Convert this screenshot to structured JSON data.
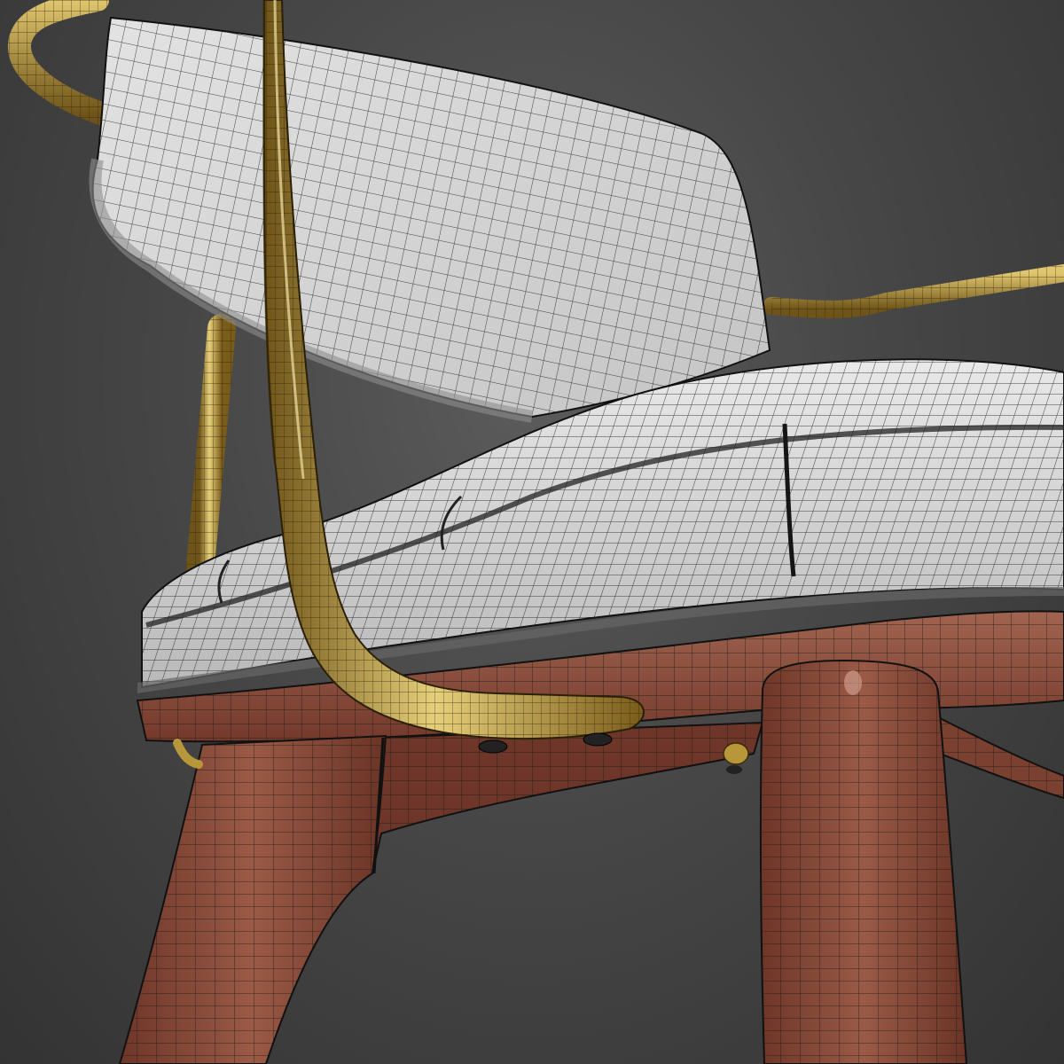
{
  "scene": {
    "subject": "armchair-wireframe-render",
    "colors": {
      "background": "#3f3f3f",
      "upholstery": "#dcdcdc",
      "upholstery_shadow": "#9a9a9a",
      "wood": "#8a4a3a",
      "wood_light": "#a86a55",
      "wood_dark": "#5a2c22",
      "brass": "#b8963a",
      "brass_light": "#e6cf7a",
      "brass_dark": "#6e5418",
      "wire": "#1a1a1a"
    }
  }
}
